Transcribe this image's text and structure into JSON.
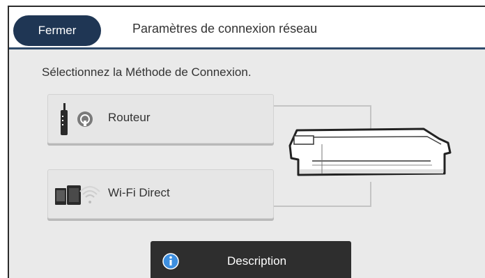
{
  "header": {
    "close_label": "Fermer",
    "title": "Paramètres de connexion réseau"
  },
  "main": {
    "prompt": "Sélectionnez la Méthode de Connexion.",
    "router_label": "Routeur",
    "wifi_direct_label": "Wi-Fi Direct",
    "description_label": "Description"
  },
  "icons": {
    "router": "router-icon",
    "wifi_direct": "wifi-direct-icon",
    "info": "info-icon",
    "printer": "printer-icon"
  },
  "colors": {
    "header_accent": "#2f4a6a",
    "close_button": "#1f3654",
    "description_button": "#2e2e2e",
    "info_icon": "#3d8fe0"
  }
}
